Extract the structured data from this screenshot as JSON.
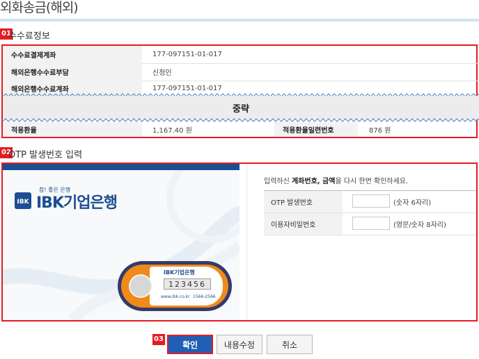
{
  "page": {
    "title": "외화송금(해외)"
  },
  "section1": {
    "badge": "01",
    "title": "수수료정보",
    "rows": [
      {
        "label": "수수료결제계좌",
        "value": "177-097151-01-017"
      },
      {
        "label": "해외은행수수료부담",
        "value": "신청인"
      },
      {
        "label": "해외은행수수료계좌",
        "value": "177-097151-01-017"
      }
    ],
    "omitted_label": "중략",
    "rate_label": "적용환율",
    "rate_value": "1,167.40 원",
    "rate_serial_label": "적용환율일련번호",
    "rate_serial_value": "876 원"
  },
  "section2": {
    "badge": "02",
    "title": "OTP 발생번호 입력",
    "brand_slogan": "참! 좋은 은행",
    "brand_name": "IBK기업은행",
    "device": {
      "brand": "IBK기업은행",
      "code": "123456",
      "url": "www.ibk.co.kr",
      "phone": "1566-2566"
    },
    "instruction_pre": "입력하신 ",
    "instruction_bold": "계좌번호, 금액",
    "instruction_post": "을 다시 한번 확인하세요.",
    "fields": [
      {
        "label": "OTP 발생번호",
        "hint": "(숫자 6자리)"
      },
      {
        "label": "이용자비밀번호",
        "hint": "(영문/숫자 8자리)"
      }
    ]
  },
  "buttons": {
    "badge": "03",
    "confirm": "확인",
    "edit": "내용수정",
    "cancel": "취소"
  },
  "colors": {
    "accent_red": "#e31b23",
    "ibk_blue": "#1c4e91",
    "button_blue": "#1f5fb5"
  }
}
